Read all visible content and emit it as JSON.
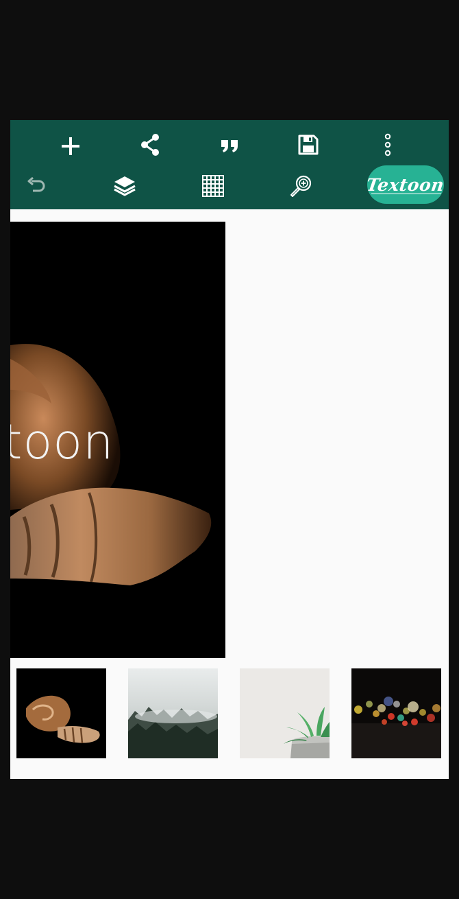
{
  "toolbar": {
    "row1": [
      {
        "name": "add",
        "icon": "plus-icon"
      },
      {
        "name": "share",
        "icon": "share-icon"
      },
      {
        "name": "quote",
        "icon": "quote-icon"
      },
      {
        "name": "save",
        "icon": "floppy-disk-icon"
      },
      {
        "name": "more",
        "icon": "more-vertical-icon"
      }
    ],
    "row2": [
      {
        "name": "undo",
        "icon": "undo-icon"
      },
      {
        "name": "layers",
        "icon": "layers-icon"
      },
      {
        "name": "grid",
        "icon": "grid-icon"
      },
      {
        "name": "zoom",
        "icon": "zoom-in-icon"
      }
    ],
    "brand_label": "Textoon"
  },
  "canvas": {
    "text": "toon"
  },
  "thumbnails": [
    {
      "name": "seashell",
      "icon": "seashell-image"
    },
    {
      "name": "misty-forest",
      "icon": "forest-image"
    },
    {
      "name": "succulent",
      "icon": "succulent-image"
    },
    {
      "name": "bokeh-lights",
      "icon": "bokeh-image"
    }
  ],
  "colors": {
    "toolbar": "#0f5346",
    "brand": "#27b294",
    "canvas_bg": "#fafafa",
    "frame": "#0e0e0e"
  }
}
